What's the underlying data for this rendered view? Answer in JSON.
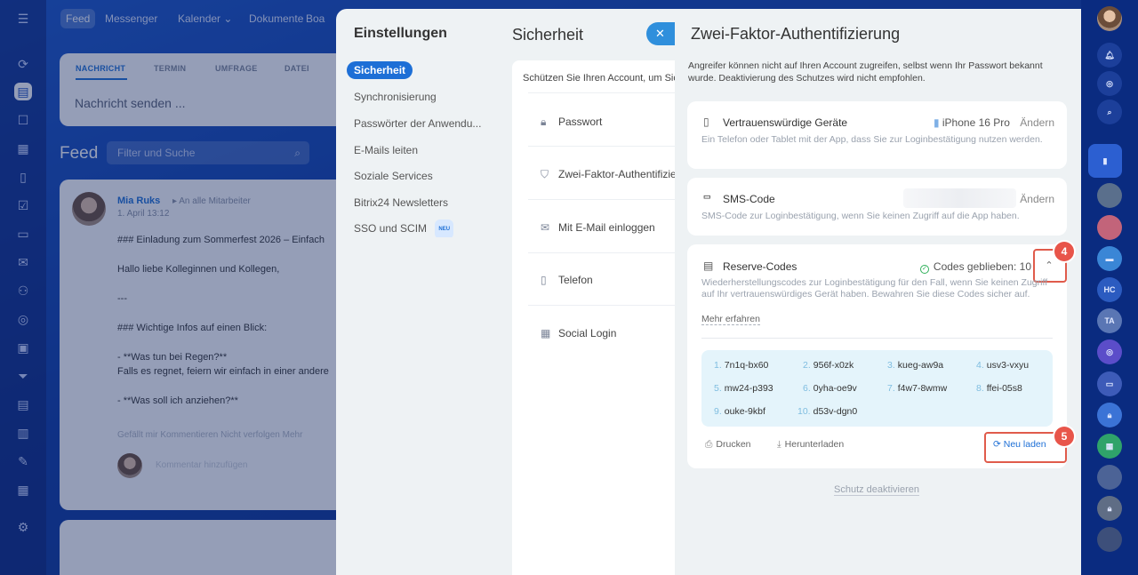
{
  "app_nav": {
    "items": [
      "Feed",
      "Messenger",
      "Kalender",
      "Dokumente",
      "Boa"
    ],
    "kalender_chevron": "⌄"
  },
  "composer": {
    "tabs": [
      "NACHRICHT",
      "TERMIN",
      "UMFRAGE",
      "DATEI"
    ],
    "input_placeholder": "Nachricht senden ..."
  },
  "feed": {
    "title": "Feed",
    "filter_placeholder": "Filter und Suche"
  },
  "post": {
    "author": "Mia Ruks",
    "recipient": "An alle Mitarbeiter",
    "date": "1. April 13:12",
    "lines": [
      "### Einladung zum Sommerfest 2026 – Einfach",
      "Hallo liebe Kolleginnen und Kollegen,",
      "---",
      "### Wichtige Infos auf einen Blick:",
      "- **Was tun bei Regen?**",
      " Falls es regnet, feiern wir einfach in einer andere",
      "- **Was soll ich anziehen?**"
    ],
    "meta": "Gefällt mir   Kommentieren   Nicht verfolgen   Mehr",
    "comment_placeholder": "Kommentar hinzufügen"
  },
  "settings": {
    "title": "Einstellungen",
    "nav": [
      "Sicherheit",
      "Synchronisierung",
      "Passwörter der Anwendu...",
      "E-Mails leiten",
      "Soziale Services",
      "Bitrix24 Newsletters",
      "SSO und SCIM"
    ],
    "new_badge": "NEU",
    "section_title": "Sicherheit",
    "intro": "Schützen Sie Ihren Account, um Sic",
    "items": [
      {
        "label": "Passwort",
        "icon": "lock-icon"
      },
      {
        "label": "Zwei-Faktor-Authentifizie",
        "icon": "shield-icon"
      },
      {
        "label": "Mit E-Mail einloggen",
        "icon": "mail-icon"
      },
      {
        "label": "Telefon",
        "icon": "phone-icon"
      },
      {
        "label": "Social Login",
        "icon": "grid-icon"
      }
    ]
  },
  "tfa": {
    "title": "Zwei-Faktor-Authentifizierung",
    "intro": "Angreifer können nicht auf Ihren Account zugreifen, selbst wenn Ihr Passwort bekannt wurde. Deaktivierung des Schutzes wird nicht empfohlen.",
    "trusted_devices": {
      "title": "Vertrauenswürdige Geräte",
      "description": "Ein Telefon oder Tablet mit der App, dass Sie zur Loginbestätigung nutzen werden.",
      "device": "iPhone 16 Pro",
      "change": "Ändern"
    },
    "sms": {
      "title": "SMS-Code",
      "description": "SMS-Code zur Loginbestätigung, wenn Sie keinen Zugriff auf die App haben.",
      "change": "Ändern"
    },
    "reserve": {
      "title": "Reserve-Codes",
      "codes_left": "Codes geblieben: 10",
      "description": "Wiederherstellungscodes zur Loginbestätigung für den Fall, wenn Sie keinen Zugriff auf Ihr vertrauenswürdiges Gerät haben. Bewahren Sie diese Codes sicher auf.",
      "learn_more": "Mehr erfahren",
      "codes": [
        {
          "n": "1.",
          "code": "7n1q-bx60"
        },
        {
          "n": "2.",
          "code": "956f-x0zk"
        },
        {
          "n": "3.",
          "code": "kueg-aw9a"
        },
        {
          "n": "4.",
          "code": "usv3-vxyu"
        },
        {
          "n": "5.",
          "code": "mw24-p393"
        },
        {
          "n": "6.",
          "code": "0yha-oe9v"
        },
        {
          "n": "7.",
          "code": "f4w7-8wmw"
        },
        {
          "n": "8.",
          "code": "ffei-05s8"
        },
        {
          "n": "9.",
          "code": "ouke-9kbf"
        },
        {
          "n": "10.",
          "code": "d53v-dgn0"
        }
      ],
      "print": "Drucken",
      "download": "Herunterladen",
      "reload": "Neu laden"
    },
    "deactivate": "Schutz deaktivieren"
  },
  "markers": [
    "4",
    "5"
  ],
  "right_rail": {
    "initials": [
      "HC",
      "TA"
    ]
  },
  "colors": {
    "accent": "#1d6fd6",
    "marker": "#e8554a",
    "codes_bg": "#e4f4fb",
    "success": "#2fb05a"
  }
}
